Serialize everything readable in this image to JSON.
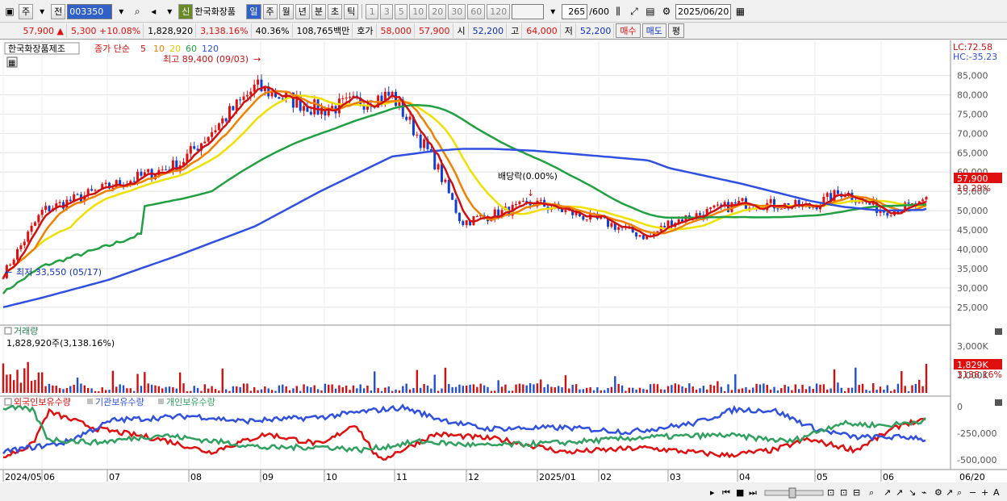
{
  "toolbar": {
    "period": "주",
    "prev": "전",
    "code": "003350",
    "stock_name": "한국화장품",
    "new_badge": "신",
    "periods": [
      "일",
      "주",
      "월",
      "년",
      "분",
      "초",
      "틱"
    ],
    "minutes": [
      "1",
      "3",
      "5",
      "10",
      "20",
      "30",
      "60",
      "120"
    ],
    "count": "265",
    "count_total": "/600",
    "date": "2025/06/20"
  },
  "quote": {
    "price": "57,900",
    "change": "5,300",
    "change_pct": "+10.08%",
    "volume": "1,828,920",
    "vol_ratio": "3,138.16%",
    "turnover_pct": "40.36%",
    "amount": "108,765백만",
    "hoga_label": "호가",
    "hoga_value": "58,000",
    "hoga_value2": "57,900",
    "open_label": "시",
    "open": "52,200",
    "high_label": "고",
    "high": "64,000",
    "low_label": "저",
    "low": "52,200",
    "buy_label": "매수",
    "sell_label": "매도",
    "avg_label": "평"
  },
  "legend": {
    "name": "한국화장품제조",
    "type": "종가 단순",
    "ma": [
      "5",
      "10",
      "20",
      "60",
      "120"
    ],
    "ma_colors": [
      "#d01010",
      "#f08000",
      "#f0e000",
      "#20a040",
      "#3050e0"
    ]
  },
  "annotations": {
    "high_note": "최고 89,400 (09/03)",
    "low_note": "최저 33,550 (05/17)",
    "dividend_note": "배당락(0.00%)",
    "lc": "LC:72.58",
    "hc": "HC:-35.23",
    "price_tag": "57,900",
    "pct_tag": "10.29%"
  },
  "volume_pane": {
    "title": "거래량",
    "value": "1,828,920주(3,138.16%)",
    "tag": "1,829K",
    "tag_pct": "3138.16%",
    "axis": [
      "3,000K",
      "1,000K"
    ]
  },
  "holdings_pane": {
    "series_names": [
      "외국인보유수량",
      "기관보유수량",
      "개인보유수량"
    ],
    "series_colors": [
      "#e01010",
      "#3050e0",
      "#30a060"
    ],
    "axis": [
      "0",
      "-250,000",
      "-500,000"
    ]
  },
  "price_axis": [
    "85,000",
    "80,000",
    "75,000",
    "70,000",
    "65,000",
    "60,000",
    "55,000",
    "50,000",
    "45,000",
    "40,000",
    "35,000",
    "30,000",
    "25,000"
  ],
  "date_axis": [
    "2024/05",
    "06",
    "07",
    "08",
    "09",
    "10",
    "11",
    "12",
    "2025/01",
    "02",
    "03",
    "04",
    "05",
    "06",
    "06/20"
  ],
  "chart_data": {
    "type": "line",
    "title": "",
    "x": [
      "2024-05-17",
      "2024-06-03",
      "2024-07-01",
      "2024-08-01",
      "2024-09-03",
      "2024-10-01",
      "2024-11-01",
      "2024-11-20",
      "2024-12-01",
      "2024-12-15",
      "2025-01-02",
      "2025-02-01",
      "2025-02-20",
      "2025-03-01",
      "2025-04-01",
      "2025-05-01",
      "2025-05-15",
      "2025-06-01",
      "2025-06-19",
      "2025-06-20"
    ],
    "series": [
      {
        "name": "5",
        "values": [
          33550,
          50000,
          56000,
          62000,
          82000,
          76000,
          80000,
          62000,
          47000,
          49000,
          52000,
          47000,
          43000,
          47000,
          52000,
          51000,
          55000,
          50000,
          51500,
          52600
        ]
      },
      {
        "name": "120",
        "values": [
          25000,
          27500,
          32000,
          38500,
          46000,
          55000,
          64000,
          65500,
          66000,
          66000,
          65500,
          64000,
          63000,
          61000,
          57000,
          52500,
          51000,
          50000,
          50200,
          50500
        ]
      }
    ],
    "ylim": [
      21000,
      92000
    ],
    "ylabel": "",
    "xlabel": ""
  }
}
